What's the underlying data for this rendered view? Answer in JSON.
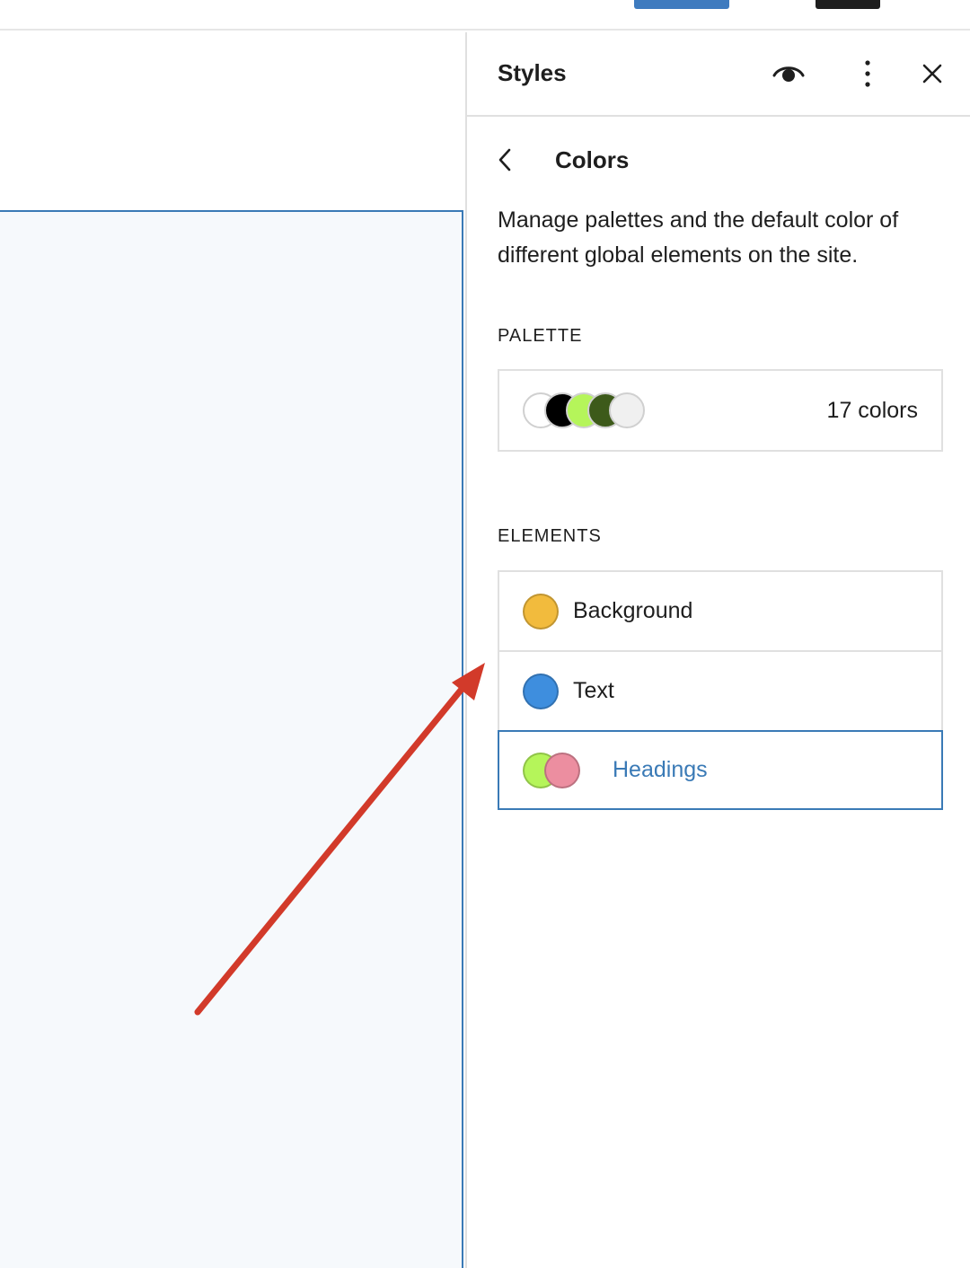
{
  "sidebar": {
    "title": "Styles",
    "nav_title": "Colors",
    "description": "Manage palettes and the default color of different global elements on the site.",
    "palette": {
      "label": "PALETTE",
      "count_text": "17 colors",
      "swatches": [
        "#ffffff",
        "#000000",
        "#b5f55a",
        "#3d5a1a",
        "#f0f0f0"
      ]
    },
    "elements": {
      "label": "ELEMENTS",
      "items": [
        {
          "label": "Background",
          "color": "#f2bb3d"
        },
        {
          "label": "Text",
          "color": "#3e8ede"
        },
        {
          "label": "Headings",
          "colors": [
            "#b5f55a",
            "#ec8ea0"
          ]
        }
      ]
    }
  },
  "colors": {
    "accent": "#3a7ab6",
    "annotation_arrow": "#d23a2a"
  },
  "icons": {
    "preview": "eye-icon",
    "more": "more-vertical-icon",
    "close": "close-icon",
    "back": "chevron-left-icon"
  }
}
